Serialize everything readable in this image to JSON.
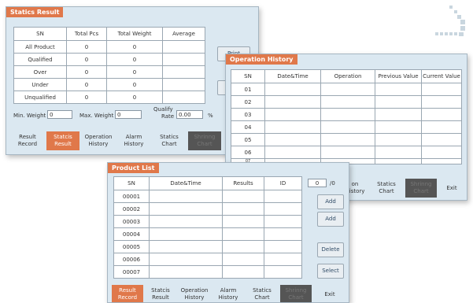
{
  "statics": {
    "title": "Statics Result",
    "headers": [
      "SN",
      "Total Pcs",
      "Total Weight",
      "Average"
    ],
    "rows": [
      [
        "All Product",
        "0",
        "0",
        ""
      ],
      [
        "Qualified",
        "0",
        "0",
        ""
      ],
      [
        "Over",
        "0",
        "0",
        ""
      ],
      [
        "Under",
        "0",
        "0",
        ""
      ],
      [
        "Unqualified",
        "0",
        "0",
        ""
      ]
    ],
    "min_label": "Min. Weight",
    "min_value": "0",
    "max_label": "Max. Weight",
    "max_value": "0",
    "qual_label_1": "Qualify",
    "qual_label_2": "Rate",
    "qual_value": "0.00",
    "pct": "%",
    "print_label": "Print",
    "tabs": [
      [
        "Result",
        "Record"
      ],
      [
        "Statcis",
        "Result"
      ],
      [
        "Operation",
        "History"
      ],
      [
        "Alarm",
        "History"
      ],
      [
        "Statics",
        "Chart"
      ],
      [
        "Shrinng",
        "Chart"
      ]
    ]
  },
  "history": {
    "title": "Operation History",
    "headers": [
      "SN",
      "Date&Time",
      "Operation",
      "Previous Value",
      "Current Value"
    ],
    "rows": [
      "01",
      "02",
      "03",
      "04",
      "05",
      "06",
      "07"
    ],
    "tabs": [
      [
        "on",
        "History"
      ],
      [
        "Statics",
        "Chart"
      ],
      [
        "Shrinng",
        "Chart"
      ],
      [
        "Exit"
      ]
    ]
  },
  "product": {
    "title": "Product List",
    "headers": [
      "SN",
      "Date&Time",
      "Results",
      "ID"
    ],
    "rows": [
      "00001",
      "00002",
      "00003",
      "00004",
      "00005",
      "00006",
      "00007"
    ],
    "page_value": "0",
    "page_total": "/0",
    "add_label": "Add",
    "add2_label": "Add",
    "delete_label": "Delete",
    "select_label": "Select",
    "tabs": [
      [
        "Result",
        "Record"
      ],
      [
        "Statcis",
        "Result"
      ],
      [
        "Operation",
        "History"
      ],
      [
        "Alarm",
        "History"
      ],
      [
        "Statics",
        "Chart"
      ],
      [
        "Shrinng",
        "Chart"
      ],
      [
        "Exit"
      ]
    ]
  },
  "colors": {
    "accent": "#e0784a",
    "panel": "#dbe8f1"
  }
}
